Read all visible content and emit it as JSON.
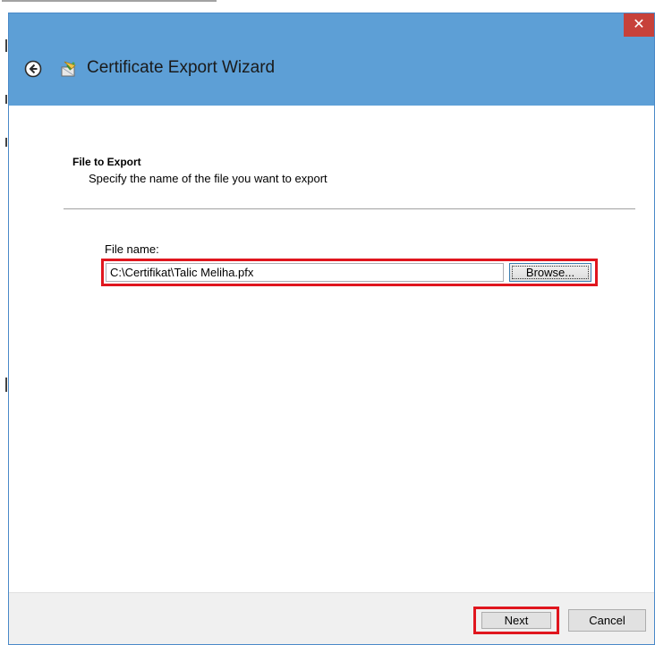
{
  "window": {
    "title": "Certificate Export Wizard",
    "close_glyph": "✕",
    "accent_color": "#5d9fd6",
    "close_color": "#c7413a",
    "highlight_color": "#e0161e"
  },
  "icons": {
    "back": "back-arrow-icon",
    "wizard": "certificate-wizard-icon",
    "close": "close-icon"
  },
  "page": {
    "heading": "File to Export",
    "description": "Specify the name of the file you want to export"
  },
  "file": {
    "label": "File name:",
    "value": "C:\\Certifikat\\Talic Meliha.pfx",
    "browse_label": "Browse..."
  },
  "footer": {
    "next_label": "Next",
    "cancel_label": "Cancel"
  }
}
